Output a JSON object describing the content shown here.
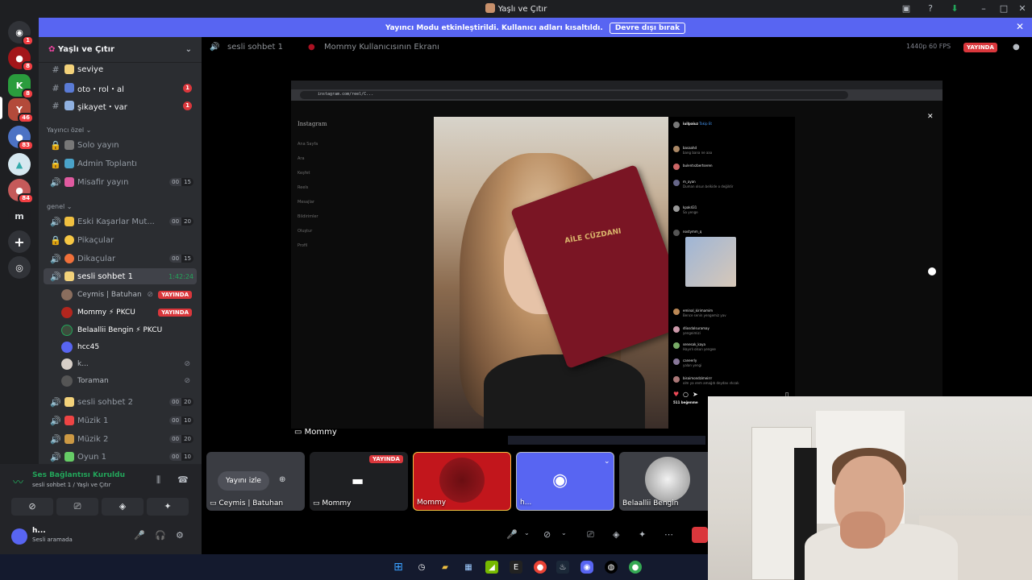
{
  "window": {
    "title": "Yaşlı ve Çıtır"
  },
  "banner": {
    "message": "Yayıncı Modu etkinleştirildi. Kullanıcı adları kısaltıldı.",
    "button": "Devre dışı bırak"
  },
  "rail": {
    "badges": [
      "1",
      "8",
      "8",
      "46",
      "83",
      "84"
    ],
    "letter_server": "m"
  },
  "server": {
    "name": "Yaşlı ve Çıtır"
  },
  "channels_top": [
    {
      "label": "seviye"
    },
    {
      "label": "oto・rol・al",
      "badge": "1"
    },
    {
      "label": "şikayet・var",
      "badge": "1"
    }
  ],
  "categories": {
    "private": "Yayıncı özel",
    "general": "genel"
  },
  "private_channels": [
    {
      "label": "Solo yayın"
    },
    {
      "label": "Admin Toplantı"
    },
    {
      "label": "Misafir yayın",
      "count_a": "00",
      "count_b": "15"
    }
  ],
  "general_channels": [
    {
      "label": "Eski Kaşarlar Mut...",
      "count_a": "00",
      "count_b": "20"
    },
    {
      "label": "Pikaçular"
    },
    {
      "label": "Dikaçular",
      "count_a": "00",
      "count_b": "15"
    },
    {
      "label": "sesli sohbet 1",
      "timer": "1:42:24"
    }
  ],
  "voice_users": [
    {
      "name": "Ceymis | Batuhan",
      "live": "YAYINDA"
    },
    {
      "name": "Mommy ⚡ PKCU",
      "live": "YAYINDA"
    },
    {
      "name": "Belaallii Bengin ⚡ PKCU"
    },
    {
      "name": "hcc45"
    },
    {
      "name": "k..."
    },
    {
      "name": "Toraman"
    }
  ],
  "more_channels": [
    {
      "label": "sesli sohbet 2",
      "count_a": "00",
      "count_b": "20"
    },
    {
      "label": "Müzik 1",
      "count_a": "00",
      "count_b": "10"
    },
    {
      "label": "Müzik 2",
      "count_a": "00",
      "count_b": "20"
    },
    {
      "label": "Oyun 1",
      "count_a": "00",
      "count_b": "10"
    }
  ],
  "voice_status": {
    "title": "Ses Bağlantısı Kuruldu",
    "subtitle": "sesli sohbet 1 / Yaşlı ve Çıtır"
  },
  "user": {
    "name": "h...",
    "status": "Sesli aramada"
  },
  "stage": {
    "channel": "sesli sohbet 1",
    "screen_title": "Mommy Kullanıcısının Ekranı",
    "quality": "1440p 60 FPS",
    "live": "YAYINDA",
    "stream_label": "Mommy",
    "url": "instagram.com/reel/C..."
  },
  "instagram": {
    "logo": "Instagram",
    "nav": [
      "Ana Sayfa",
      "Ara",
      "Keşfet",
      "Reels",
      "Mesajlar",
      "Bildirimler",
      "Oluştur",
      "Profil"
    ],
    "book_text": "AİLE CÜZDANI",
    "comments": [
      {
        "user": "iuilpaiuz",
        "text": "Takip Et"
      },
      {
        "user": "basaahd",
        "text": "bang bana ne aaa"
      },
      {
        "user": "bulentvzbertseren",
        "text": ""
      },
      {
        "user": "m_ayan",
        "text": "Duman olsun belkide o değildir"
      },
      {
        "user": "kpak431",
        "text": "Sa yenge"
      },
      {
        "user": "nostymm_q",
        "text": ""
      },
      {
        "user": "eminal_kirimamim",
        "text": "Bence senin yengemiz yav"
      },
      {
        "user": "dliosdalsuramay",
        "text": "yengeimizi"
      },
      {
        "user": "senesak_kaya",
        "text": "Hayırlı olsun yengee"
      },
      {
        "user": "caneerly",
        "text": "yalan yengi"
      },
      {
        "user": "bisaimondzimeirrr",
        "text": "olm ya ırem amağıtı deydav ırkcak"
      }
    ],
    "likes": "511 beğenme"
  },
  "tiles": [
    {
      "name": "Ceymis | Batuhan",
      "action": "Yayını izle"
    },
    {
      "name": "Mommy",
      "live": "YAYINDA"
    },
    {
      "name": "Mommy"
    },
    {
      "name": "h..."
    },
    {
      "name": "Belaallii Bengin"
    }
  ]
}
